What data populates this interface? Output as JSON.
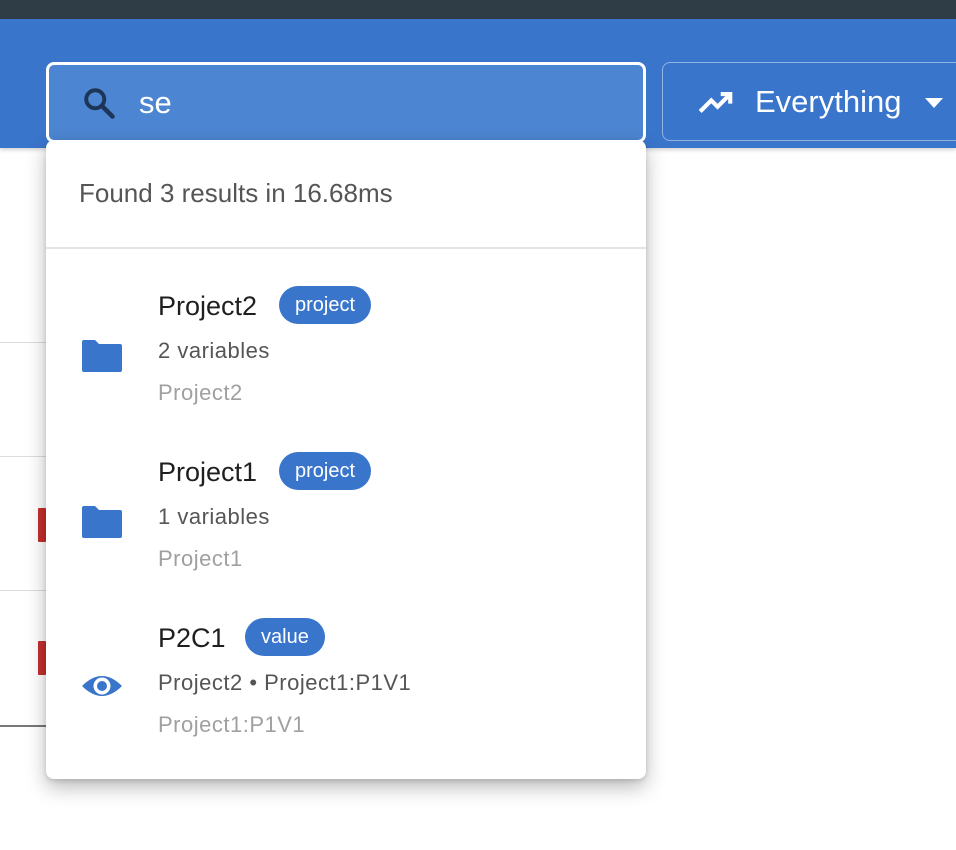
{
  "search": {
    "value": "se",
    "icon": "search-icon"
  },
  "scope": {
    "label": "Everything",
    "icon": "trending-up-icon"
  },
  "dropdown": {
    "summary": "Found 3 results in 16.68ms",
    "results": [
      {
        "title": "Project2",
        "badge": "project",
        "subtitle": "2 variables",
        "path": "Project2",
        "icon": "folder-icon"
      },
      {
        "title": "Project1",
        "badge": "project",
        "subtitle": "1 variables",
        "path": "Project1",
        "icon": "folder-icon"
      },
      {
        "title": "P2C1",
        "badge": "value",
        "subtitle": "Project2 • Project1:P1V1",
        "path": "Project1:P1V1",
        "icon": "eye-icon"
      }
    ]
  },
  "colors": {
    "primary": "#3a75cc",
    "danger": "#c62f2f",
    "topbar": "#2f3e46"
  }
}
